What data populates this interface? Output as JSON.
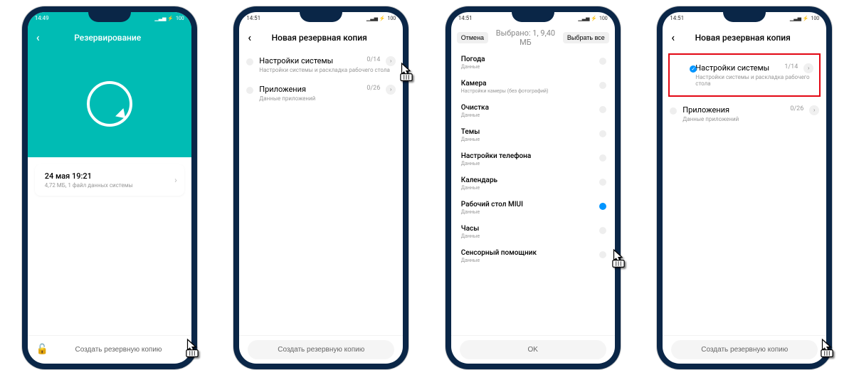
{
  "screens": [
    {
      "time": "14:49",
      "battery": "100",
      "title": "Резервирование",
      "backup_card": {
        "title": "24 мая 19:21",
        "subtitle": "4,72 МБ, 1 файл данных системы"
      },
      "lock": true,
      "bottom_button": "Создать резервную копию"
    },
    {
      "time": "14:51",
      "battery": "100",
      "title": "Новая резервная копия",
      "rows": [
        {
          "title": "Настройки системы",
          "subtitle": "Настройки системы и раскладка рабочего стола",
          "count": "0/14",
          "checked": false
        },
        {
          "title": "Приложения",
          "subtitle": "Данные приложений",
          "count": "0/26",
          "checked": false
        }
      ],
      "bottom_button": "Создать резервную копию"
    },
    {
      "time": "14:51",
      "battery": "100",
      "cancel": "Отмена",
      "sel_title": "Выбрано: 1, 9,40 МБ",
      "select_all": "Выбрать все",
      "items": [
        {
          "title": "Погода",
          "subtitle": "Данные",
          "checked": false
        },
        {
          "title": "Камера",
          "subtitle": "Настройки камеры (без фотографий)",
          "checked": false
        },
        {
          "title": "Очистка",
          "subtitle": "Данные",
          "checked": false
        },
        {
          "title": "Темы",
          "subtitle": "Данные",
          "checked": false
        },
        {
          "title": "Настройки телефона",
          "subtitle": "Данные",
          "checked": false
        },
        {
          "title": "Календарь",
          "subtitle": "Данные",
          "checked": false
        },
        {
          "title": "Рабочий стол MIUI",
          "subtitle": "Данные",
          "checked": true
        },
        {
          "title": "Часы",
          "subtitle": "Данные",
          "checked": false
        },
        {
          "title": "Сенсорный помощник",
          "subtitle": "Данные",
          "checked": false
        }
      ],
      "bottom_button": "OK"
    },
    {
      "time": "14:51",
      "battery": "100",
      "title": "Новая резервная копия",
      "rows": [
        {
          "title": "Настройки системы",
          "subtitle": "Настройки системы и раскладка рабочего стола",
          "count": "1/14",
          "checked": true,
          "highlight": true
        },
        {
          "title": "Приложения",
          "subtitle": "Данные приложений",
          "count": "0/26",
          "checked": false
        }
      ],
      "bottom_button": "Создать резервную копию"
    }
  ]
}
